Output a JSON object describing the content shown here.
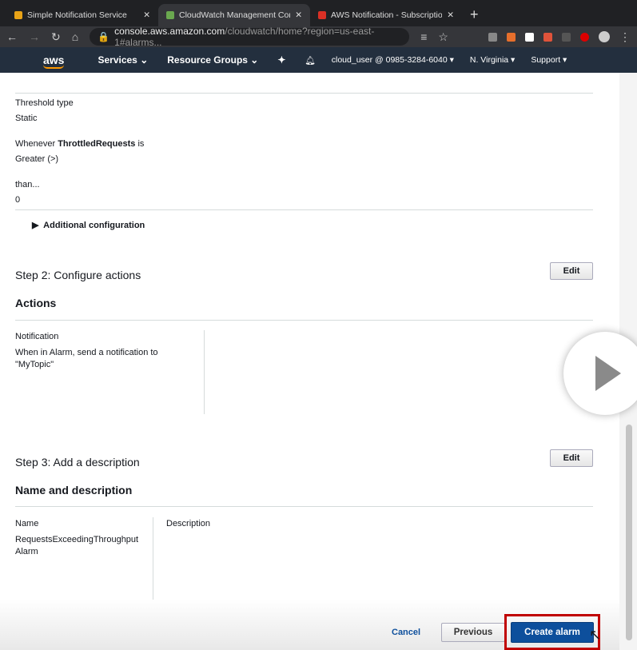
{
  "browser": {
    "tabs": [
      {
        "label": "Simple Notification Service",
        "color": "#e8a317"
      },
      {
        "label": "CloudWatch Management Con",
        "color": "#6aa84f"
      },
      {
        "label": "AWS Notification - Subscriptio",
        "color": "#d93025"
      }
    ],
    "url_host": "console.aws.amazon.com",
    "url_path": "/cloudwatch/home?region=us-east-1#alarms..."
  },
  "nav": {
    "logo": "aws",
    "services": "Services",
    "resource_groups": "Resource Groups",
    "account": "cloud_user @ 0985-3284-6040",
    "region": "N. Virginia",
    "support": "Support"
  },
  "conditions": {
    "threshold_type_label": "Threshold type",
    "threshold_type": "Static",
    "whenever_prefix": "Whenever ",
    "metric": "ThrottledRequests",
    "whenever_suffix": " is",
    "operator": "Greater (>)",
    "than_label": "than...",
    "than_value": "0",
    "additional_config": "Additional configuration"
  },
  "step2": {
    "title": "Step 2: Configure actions",
    "edit": "Edit",
    "section": "Actions",
    "notification_label": "Notification",
    "notification_text": "When in Alarm, send a notification to \"MyTopic\""
  },
  "step3": {
    "title": "Step 3: Add a description",
    "edit": "Edit",
    "section": "Name and description",
    "name_label": "Name",
    "name_value": "RequestsExceedingThroughput Alarm",
    "description_label": "Description"
  },
  "footer": {
    "cancel": "Cancel",
    "previous": "Previous",
    "create": "Create alarm",
    "create_color": "#0d4f9c",
    "highlight_color": "#c00000"
  }
}
